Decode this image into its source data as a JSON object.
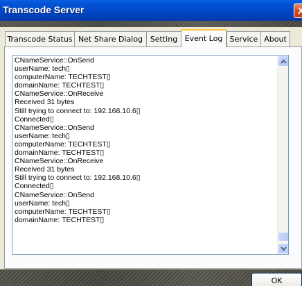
{
  "window": {
    "title": "Transcode Server",
    "close_label": "X"
  },
  "tabs": [
    {
      "label": "Transcode Status",
      "active": false
    },
    {
      "label": "Net Share Dialog",
      "active": false
    },
    {
      "label": "Setting",
      "active": false
    },
    {
      "label": "Event Log",
      "active": true
    },
    {
      "label": "Service",
      "active": false
    },
    {
      "label": "About",
      "active": false
    }
  ],
  "event_log": {
    "lines": [
      "CNameService::OnSend",
      "userName: tech▯",
      "computerName: TECHTEST▯",
      "domainName: TECHTEST▯",
      "CNameService::OnReceive",
      "Received 31 bytes",
      "Still trying to connect to: 192.168.10.6▯",
      "Connected▯",
      "CNameService::OnSend",
      "userName: tech▯",
      "computerName: TECHTEST▯",
      "domainName: TECHTEST▯",
      "CNameService::OnReceive",
      "Received 31 bytes",
      "Still trying to connect to: 192.168.10.6▯",
      "Connected▯",
      "CNameService::OnSend",
      "userName: tech▯",
      "computerName: TECHTEST▯",
      "domainName: TECHTEST▯"
    ]
  },
  "footer": {
    "ok_label": "OK"
  },
  "colors": {
    "titlebar": "#0149c7",
    "face": "#ece9d8",
    "active_tab_highlight": "#ffc83c",
    "scrollbar": "#c8d8fa"
  }
}
